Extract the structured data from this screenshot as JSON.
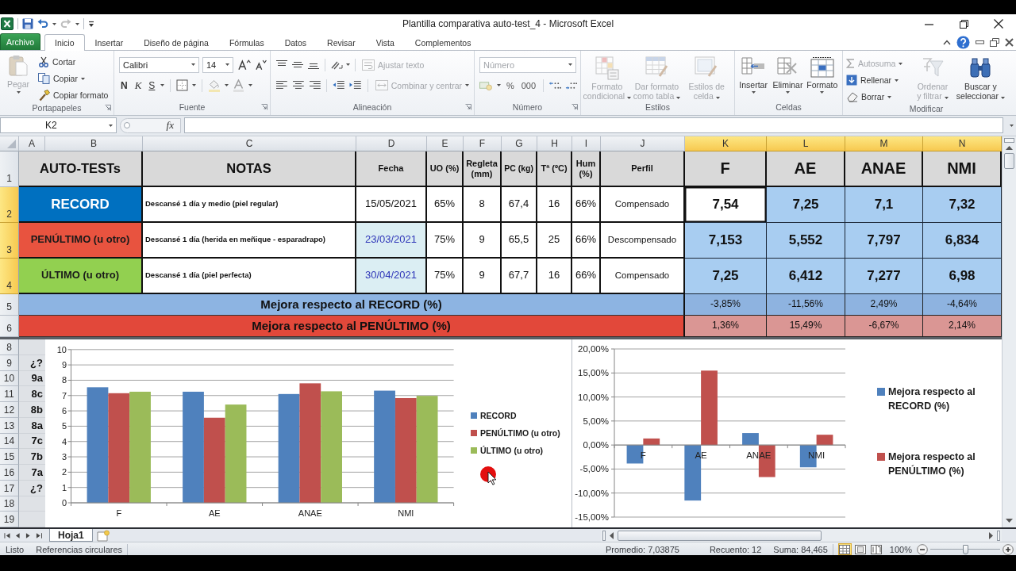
{
  "window": {
    "title": "Plantilla comparativa auto-test_4 - Microsoft Excel"
  },
  "ribbon_tabs": [
    {
      "label": "Archivo",
      "kind": "file",
      "selected": false
    },
    {
      "label": "Inicio",
      "kind": "tab",
      "selected": true
    },
    {
      "label": "Insertar",
      "kind": "tab",
      "selected": false
    },
    {
      "label": "Diseño de página",
      "kind": "tab",
      "selected": false
    },
    {
      "label": "Fórmulas",
      "kind": "tab",
      "selected": false
    },
    {
      "label": "Datos",
      "kind": "tab",
      "selected": false
    },
    {
      "label": "Revisar",
      "kind": "tab",
      "selected": false
    },
    {
      "label": "Vista",
      "kind": "tab",
      "selected": false
    },
    {
      "label": "Complementos",
      "kind": "tab",
      "selected": false
    }
  ],
  "ribbon": {
    "clipboard": {
      "label": "Portapapeles",
      "paste": {
        "label": "Pegar",
        "disabled": true
      },
      "cut": {
        "label": "Cortar",
        "disabled": false
      },
      "copy": {
        "label": "Copiar",
        "disabled": false
      },
      "painter": {
        "label": "Copiar formato",
        "disabled": false
      }
    },
    "font": {
      "label": "Fuente",
      "name": "Calibri",
      "size": "14",
      "bold": "N",
      "italic": "K",
      "underline": "S"
    },
    "alignment": {
      "label": "Alineación",
      "wrap": {
        "label": "Ajustar texto",
        "disabled": true
      },
      "merge": {
        "label": "Combinar y centrar",
        "disabled": true
      }
    },
    "number": {
      "label": "Número",
      "format": {
        "value": "Número",
        "disabled": true
      },
      "percent": "%",
      "thousands": "000"
    },
    "styles": {
      "label": "Estilos",
      "buttons": [
        {
          "label": "Formato condicional",
          "disabled": true
        },
        {
          "label": "Dar formato como tabla",
          "disabled": true
        },
        {
          "label": "Estilos de celda",
          "disabled": true
        }
      ]
    },
    "cells": {
      "label": "Celdas",
      "buttons": [
        {
          "label": "Insertar",
          "disabled": false
        },
        {
          "label": "Eliminar",
          "disabled": false
        },
        {
          "label": "Formato",
          "disabled": false
        }
      ]
    },
    "editing": {
      "label": "Modificar",
      "autosum": {
        "label": "Autosuma",
        "disabled": true
      },
      "fill": {
        "label": "Rellenar",
        "disabled": false
      },
      "clear": {
        "label": "Borrar",
        "disabled": false
      },
      "sort": {
        "label": "Ordenar y filtrar",
        "disabled": true
      },
      "find": {
        "label": "Buscar y seleccionar",
        "disabled": false
      }
    }
  },
  "formula_bar": {
    "name_box": "K2",
    "function_label": "fx"
  },
  "sheet": {
    "columns": [
      {
        "letter": "A",
        "selected": false
      },
      {
        "letter": "B",
        "selected": false
      },
      {
        "letter": "C",
        "selected": false
      },
      {
        "letter": "D",
        "selected": false
      },
      {
        "letter": "E",
        "selected": false
      },
      {
        "letter": "F",
        "selected": false
      },
      {
        "letter": "G",
        "selected": false
      },
      {
        "letter": "H",
        "selected": false
      },
      {
        "letter": "I",
        "selected": false
      },
      {
        "letter": "J",
        "selected": false
      },
      {
        "letter": "K",
        "selected": true
      },
      {
        "letter": "L",
        "selected": true
      },
      {
        "letter": "M",
        "selected": true
      },
      {
        "letter": "N",
        "selected": true
      }
    ],
    "row_headers": [
      {
        "number": "1",
        "selected": false
      },
      {
        "number": "2",
        "selected": true
      },
      {
        "number": "3",
        "selected": true
      },
      {
        "number": "4",
        "selected": true
      },
      {
        "number": "5",
        "selected": false
      },
      {
        "number": "6",
        "selected": false
      }
    ],
    "header_cells": [
      "AUTO-TESTs",
      "NOTAS",
      "Fecha",
      "UO (%)",
      "Regleta (mm)",
      "PC (kg)",
      "Tª (ºC)",
      "Hum (%)",
      "Perfil"
    ],
    "metric_headers": [
      "F",
      "AE",
      "ANAE",
      "NMI"
    ],
    "records": [
      {
        "label": "RECORD",
        "kind": "record",
        "color": "#0070c0",
        "notes": "Descansé 1 día y medio (piel regular)",
        "date": {
          "text": "15/05/2021",
          "highlighted": false
        },
        "values": [
          "65%",
          "8",
          "67,4",
          "16",
          "66%",
          "Compensado"
        ],
        "metrics": [
          {
            "value": "7,54",
            "selected": false,
            "active": true
          },
          {
            "value": "7,25",
            "selected": true,
            "active": false
          },
          {
            "value": "7,1",
            "selected": true,
            "active": false
          },
          {
            "value": "7,32",
            "selected": true,
            "active": false
          }
        ]
      },
      {
        "label": "PENÚLTIMO (u otro)",
        "kind": "other",
        "color": "#e8533f",
        "notes": "Descansé 1 día (herida en meñique - esparadrapo)",
        "date": {
          "text": "23/03/2021",
          "highlighted": true
        },
        "values": [
          "75%",
          "9",
          "65,5",
          "25",
          "66%",
          "Descompensado"
        ],
        "metrics": [
          {
            "value": "7,153",
            "selected": true,
            "active": false
          },
          {
            "value": "5,552",
            "selected": true,
            "active": false
          },
          {
            "value": "7,797",
            "selected": true,
            "active": false
          },
          {
            "value": "6,834",
            "selected": true,
            "active": false
          }
        ]
      },
      {
        "label": "ÚLTIMO (u otro)",
        "kind": "other",
        "color": "#92d050",
        "notes": "Descansé 1 día (piel perfecta)",
        "date": {
          "text": "30/04/2021",
          "highlighted": true
        },
        "values": [
          "75%",
          "9",
          "67,7",
          "16",
          "66%",
          "Compensado"
        ],
        "metrics": [
          {
            "value": "7,25",
            "selected": true,
            "active": false
          },
          {
            "value": "6,412",
            "selected": true,
            "active": false
          },
          {
            "value": "7,277",
            "selected": true,
            "active": false
          },
          {
            "value": "6,98",
            "selected": true,
            "active": false
          }
        ]
      }
    ],
    "summary": [
      {
        "label": "Mejora respecto al RECORD (%)",
        "color": "#8db4e2",
        "values": [
          {
            "text": "-3,85%",
            "color": "#8eb3e0"
          },
          {
            "text": "-11,56%",
            "color": "#8eb3e0"
          },
          {
            "text": "2,49%",
            "color": "#8eb3e0"
          },
          {
            "text": "-4,64%",
            "color": "#8eb3e0"
          }
        ]
      },
      {
        "label": "Mejora respecto al PENÚLTIMO (%)",
        "color": "#e2483a",
        "values": [
          {
            "text": "1,36%",
            "color": "#da9694"
          },
          {
            "text": "15,49%",
            "color": "#da9694"
          },
          {
            "text": "-6,67%",
            "color": "#da9694"
          },
          {
            "text": "2,14%",
            "color": "#da9694"
          }
        ]
      }
    ],
    "lower_rows": [
      {
        "number": "8",
        "selected": false
      },
      {
        "number": "9",
        "selected": false,
        "label": "¿?"
      },
      {
        "number": "10",
        "selected": false,
        "label": "9a"
      },
      {
        "number": "11",
        "selected": false,
        "label": "8c"
      },
      {
        "number": "12",
        "selected": false,
        "label": "8b"
      },
      {
        "number": "13",
        "selected": false,
        "label": "8a"
      },
      {
        "number": "14",
        "selected": false,
        "label": "7c"
      },
      {
        "number": "15",
        "selected": false,
        "label": "7b"
      },
      {
        "number": "16",
        "selected": false,
        "label": "7a"
      },
      {
        "number": "17",
        "selected": false,
        "label": "¿?"
      },
      {
        "number": "18",
        "selected": false
      },
      {
        "number": "19",
        "selected": false
      }
    ],
    "charts": [
      {
        "chart_data": {
          "type": "bar",
          "categories": [
            "F",
            "AE",
            "ANAE",
            "NMI"
          ],
          "series": [
            {
              "name": "RECORD",
              "color": "#4f81bd",
              "values": [
                7.54,
                7.25,
                7.1,
                7.32
              ]
            },
            {
              "name": "PENÚLTIMO (u otro)",
              "color": "#c0504d",
              "values": [
                7.153,
                5.552,
                7.797,
                6.834
              ]
            },
            {
              "name": "ÚLTIMO (u otro)",
              "color": "#9bbb59",
              "values": [
                7.25,
                6.412,
                7.277,
                6.98
              ]
            }
          ],
          "ylim": [
            0,
            10
          ],
          "yticks": [
            0,
            1,
            2,
            3,
            4,
            5,
            6,
            7,
            8,
            9,
            10
          ],
          "grid": true,
          "legend": "right"
        }
      },
      {
        "chart_data": {
          "type": "bar",
          "categories": [
            "F",
            "AE",
            "ANAE",
            "NMI"
          ],
          "series": [
            {
              "name": "Mejora respecto al RECORD (%)",
              "color": "#4f81bd",
              "values": [
                -3.85,
                -11.56,
                2.49,
                -4.64
              ]
            },
            {
              "name": "Mejora respecto al PENÚLTIMO (%)",
              "color": "#c0504d",
              "values": [
                1.36,
                15.49,
                -6.67,
                2.14
              ]
            }
          ],
          "ylim": [
            -15,
            20
          ],
          "yticks": [
            {
              "value": -15,
              "label": "-15,00%"
            },
            {
              "value": -10,
              "label": "-10,00%"
            },
            {
              "value": -5,
              "label": "-5,00%"
            },
            {
              "value": 0,
              "label": "0,00%"
            },
            {
              "value": 5,
              "label": "5,00%"
            },
            {
              "value": 10,
              "label": "10,00%"
            },
            {
              "value": 15,
              "label": "15,00%"
            },
            {
              "value": 20,
              "label": "20,00%"
            }
          ],
          "grid": true,
          "legend": "right"
        }
      }
    ]
  },
  "sheet_tabs": [
    {
      "label": "Hoja1",
      "selected": true
    }
  ],
  "status_bar": {
    "mode": "Listo",
    "circular_refs": "Referencias circulares",
    "average": "Promedio: 7,03875",
    "count": "Recuento: 12",
    "sum": "Suma: 84,465",
    "views": [
      {
        "kind": "normal",
        "selected": true
      },
      {
        "kind": "page_layout",
        "selected": false
      },
      {
        "kind": "page_break",
        "selected": false
      }
    ],
    "zoom": "100%",
    "zoom_slider": {
      "level": 0.5
    }
  }
}
